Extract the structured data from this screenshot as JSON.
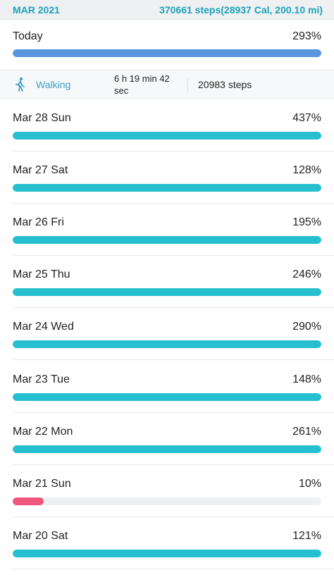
{
  "header": {
    "month": "MAR 2021",
    "summary": "370661 steps(28937 Cal, 200.10 mi)"
  },
  "colors": {
    "accent": "#1aa3b8",
    "today_bar": "#5a95de",
    "day_bar": "#26bfcf",
    "low_bar": "#f0567d",
    "track": "#eef0f2"
  },
  "today": {
    "label": "Today",
    "percent": "293%",
    "fill_fraction": 1.0
  },
  "activity": {
    "icon": "walking-person-icon",
    "type": "Walking",
    "duration": "6 h 19 min 42 sec",
    "steps": "20983 steps"
  },
  "days": [
    {
      "label": "Mar 28 Sun",
      "percent": "437%",
      "fill_fraction": 1.0
    },
    {
      "label": "Mar 27 Sat",
      "percent": "128%",
      "fill_fraction": 1.0
    },
    {
      "label": "Mar 26 Fri",
      "percent": "195%",
      "fill_fraction": 1.0
    },
    {
      "label": "Mar 25 Thu",
      "percent": "246%",
      "fill_fraction": 1.0
    },
    {
      "label": "Mar 24 Wed",
      "percent": "290%",
      "fill_fraction": 1.0
    },
    {
      "label": "Mar 23 Tue",
      "percent": "148%",
      "fill_fraction": 1.0
    },
    {
      "label": "Mar 22 Mon",
      "percent": "261%",
      "fill_fraction": 1.0
    },
    {
      "label": "Mar 21 Sun",
      "percent": "10%",
      "fill_fraction": 0.1
    },
    {
      "label": "Mar 20 Sat",
      "percent": "121%",
      "fill_fraction": 1.0
    }
  ]
}
